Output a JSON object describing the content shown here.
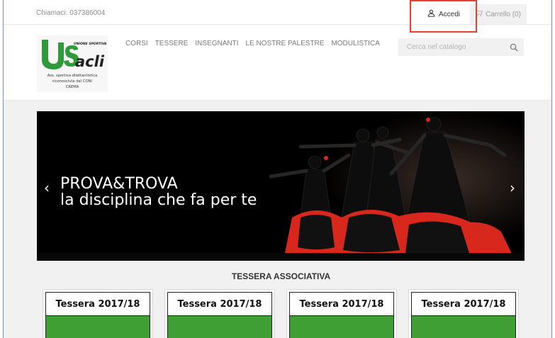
{
  "topbar": {
    "phone_text": "Chiamaci: 037386004",
    "login_label": "Accedi",
    "cart_label": "Carrello (0)"
  },
  "logo": {
    "text_main": "acli",
    "text_tag": "UNIONE SPORTIVA",
    "line1": "Ass. sportiva dilettantistica",
    "line2": "riconosciuta dal CONI",
    "line3": "CREMA"
  },
  "nav": {
    "items": [
      "CORSI",
      "TESSERE",
      "INSEGNANTI",
      "LE NOSTRE PALESTRE",
      "MODULISTICA"
    ]
  },
  "search": {
    "placeholder": "Cerca nel catalogo"
  },
  "carousel": {
    "title": "PROVA&TROVA",
    "subtitle": "la disciplina che fa per te",
    "prev_glyph": "‹",
    "next_glyph": "›"
  },
  "section": {
    "title": "TESSERA ASSOCIATIVA"
  },
  "cards": [
    {
      "title": "Tessera 2017/18"
    },
    {
      "title": "Tessera 2017/18"
    },
    {
      "title": "Tessera 2017/18"
    },
    {
      "title": "Tessera 2017/18"
    }
  ],
  "colors": {
    "card_green": "#3f9e34",
    "logo_green": "#2f9a3a",
    "highlight_red": "#e8402c",
    "dress_red": "#d8281e"
  },
  "icons": {
    "login": "user-icon",
    "cart": "cart-icon",
    "search": "search-icon"
  }
}
